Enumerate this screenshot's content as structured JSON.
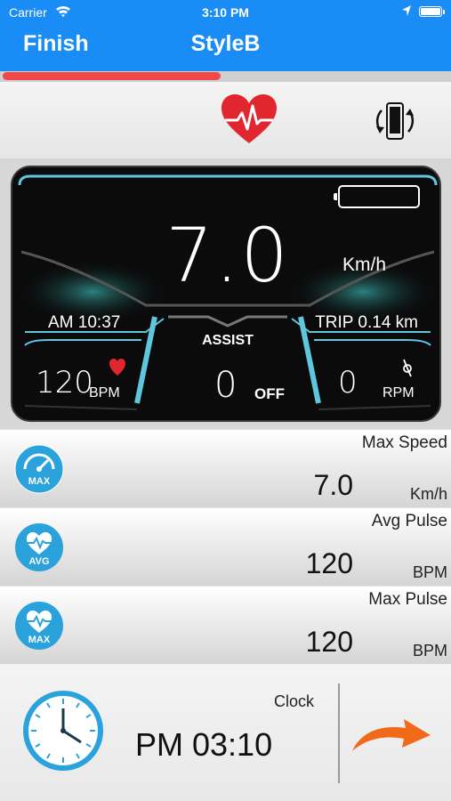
{
  "status_bar": {
    "carrier": "Carrier",
    "time": "3:10 PM"
  },
  "nav": {
    "finish_label": "Finish",
    "title": "StyleB"
  },
  "progress": {
    "fraction": 0.49,
    "color": "#f24848"
  },
  "toolbar": {
    "heart_icon": "heart-pulse-icon",
    "rotate_icon": "rotate-phone-icon"
  },
  "dashboard": {
    "speed": "7.0",
    "speed_unit": "Km/h",
    "clock": "AM 10:37",
    "trip": "TRIP 0.14 km",
    "pulse": "120",
    "pulse_unit": "BPM",
    "assist_label": "ASSIST",
    "assist_value": "0",
    "assist_state": "OFF",
    "rpm": "0",
    "rpm_unit": "RPM",
    "accent_color": "#5fc6e0"
  },
  "stats": [
    {
      "label": "Max Speed",
      "value": "7.0",
      "unit": "Km/h",
      "badge": "MAX",
      "icon": "speedometer-icon"
    },
    {
      "label": "Avg Pulse",
      "value": "120",
      "unit": "BPM",
      "badge": "AVG",
      "icon": "heart-pulse-icon"
    },
    {
      "label": "Max Pulse",
      "value": "120",
      "unit": "BPM",
      "badge": "MAX",
      "icon": "heart-pulse-icon"
    }
  ],
  "bottom": {
    "clock_label": "Clock",
    "clock_value": "PM 03:10",
    "arrow_color": "#f06a1a"
  },
  "colors": {
    "nav_blue": "#1a8cf5",
    "badge_blue": "#2aa3dc"
  }
}
